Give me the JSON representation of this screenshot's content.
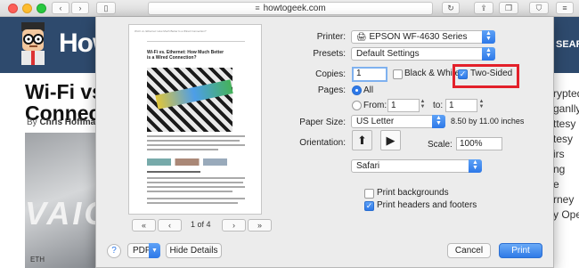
{
  "browser": {
    "url": "howtogeek.com"
  },
  "website": {
    "logo": "How",
    "search_label": "SEARC",
    "article_title_1": "Wi-Fi vs.",
    "article_title_2": "Connecti",
    "byline_prefix": "By",
    "author": "Chris Hoffman",
    "image_text": "VAIO",
    "image_port_label": "ETH",
    "right_column": [
      "rypted",
      "ganlly",
      "ttesy",
      "tesy",
      "irs",
      "ng",
      "e",
      "rney",
      "y Ope"
    ]
  },
  "preview": {
    "page_header": "Wi-Fi vs. Ethernet: How Much Better Is a Wired Connection?",
    "page_title": "Wi-Fi vs. Ethernet: How Much Better is a Wired Connection?",
    "page_indicator": "1 of 4",
    "first_label": "«",
    "prev_label": "‹",
    "next_label": "›",
    "last_label": "»"
  },
  "print": {
    "printer_label": "Printer:",
    "printer_value": "EPSON WF-4630 Series",
    "presets_label": "Presets:",
    "presets_value": "Default Settings",
    "copies_label": "Copies:",
    "copies_value": "1",
    "bw_label": "Black & White",
    "two_sided_label": "Two-Sided",
    "pages_label": "Pages:",
    "all_label": "All",
    "from_label": "From:",
    "from_value": "1",
    "to_label": "to:",
    "to_value": "1",
    "paper_size_label": "Paper Size:",
    "paper_size_value": "US Letter",
    "paper_dimensions": "8.50 by 11.00 inches",
    "orientation_label": "Orientation:",
    "scale_label": "Scale:",
    "scale_value": "100%",
    "section_value": "Safari",
    "print_backgrounds_label": "Print backgrounds",
    "print_headers_label": "Print headers and footers",
    "two_sided_checked": true,
    "bw_checked": false,
    "print_backgrounds_checked": false,
    "print_headers_checked": true,
    "pages_selection": "All"
  },
  "footer": {
    "help_label": "?",
    "pdf_label": "PDF",
    "hide_details_label": "Hide Details",
    "cancel_label": "Cancel",
    "print_label": "Print"
  },
  "colors": {
    "accent": "#2d78e8",
    "highlight": "#e3202a",
    "site_header": "#2e4a6d"
  }
}
